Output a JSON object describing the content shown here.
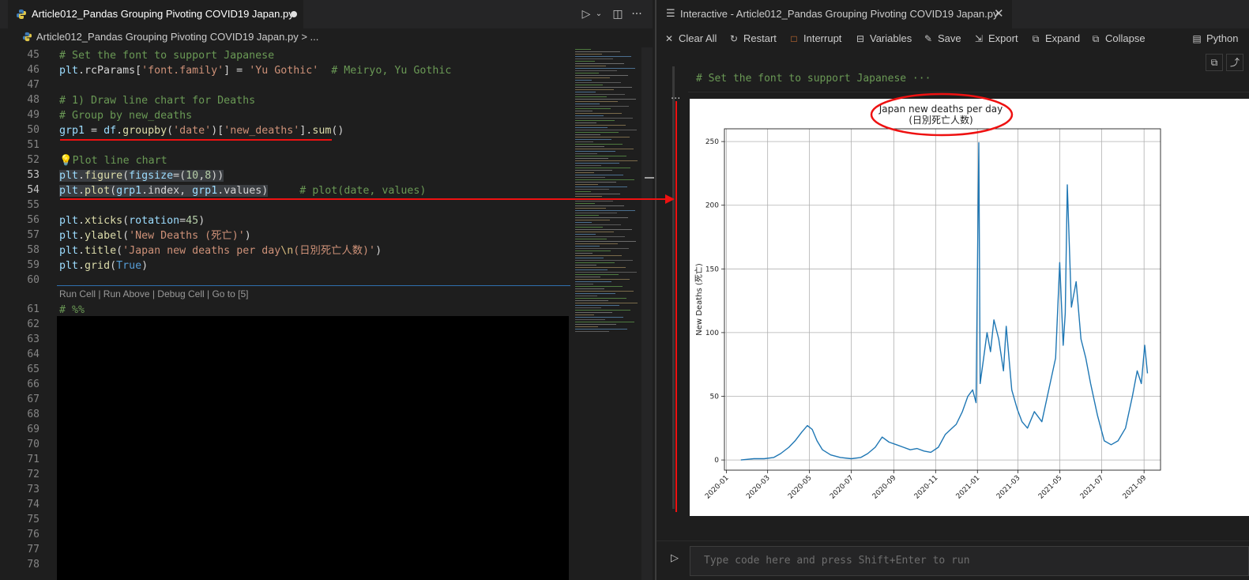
{
  "editor": {
    "tab_title": "Article012_Pandas Grouping Pivoting COVID19 Japan.py",
    "breadcrumb_file": "Article012_Pandas Grouping Pivoting COVID19 Japan.py",
    "breadcrumb_more": "> ...",
    "codelens": "Run Cell | Run Above | Debug Cell | Go to [5]",
    "line_numbers": [
      "45",
      "46",
      "47",
      "48",
      "49",
      "50",
      "51",
      "52",
      "53",
      "54",
      "55",
      "56",
      "57",
      "58",
      "59",
      "60",
      "61",
      "62",
      "63",
      "64",
      "65",
      "66",
      "67",
      "68",
      "69",
      "70",
      "71",
      "72",
      "73",
      "74",
      "75",
      "76",
      "77",
      "78"
    ],
    "code": {
      "l45": "# Set the font to support Japanese",
      "l46a": "plt",
      "l46b": ".rcParams[",
      "l46c": "'font.family'",
      "l46d": "] = ",
      "l46e": "'Yu Gothic'",
      "l46f": "  # Meiryo, Yu Gothic",
      "l48": "# 1) Draw line chart for Deaths",
      "l49": "# Group by new_deaths",
      "l50a": "grp1",
      "l50b": " = ",
      "l50c": "df",
      "l50d": ".",
      "l50e": "groupby",
      "l50f": "(",
      "l50g": "'date'",
      "l50h": ")[",
      "l50i": "'new_deaths'",
      "l50j": "].",
      "l50k": "sum",
      "l50l": "()",
      "l52": "Plot line chart",
      "l53a": "plt",
      "l53b": ".",
      "l53c": "figure",
      "l53d": "(",
      "l53e": "figsize",
      "l53f": "=(",
      "l53g": "10",
      "l53h": ",",
      "l53i": "8",
      "l53j": "))",
      "l54a": "plt",
      "l54b": ".",
      "l54c": "plot",
      "l54d": "(",
      "l54e": "grp1",
      "l54f": ".index, ",
      "l54g": "grp1",
      "l54h": ".values)",
      "l54i": "     # plot(date, values)",
      "l56a": "plt",
      "l56b": ".",
      "l56c": "xticks",
      "l56d": "(",
      "l56e": "rotation",
      "l56f": "=",
      "l56g": "45",
      "l56h": ")",
      "l57a": "plt",
      "l57b": ".",
      "l57c": "ylabel",
      "l57d": "(",
      "l57e": "'New Deaths (死亡)'",
      "l57f": ")",
      "l58a": "plt",
      "l58b": ".",
      "l58c": "title",
      "l58d": "(",
      "l58e": "'Japan new deaths per day",
      "l58f": "\\n",
      "l58g": "(日別死亡人数)'",
      "l58h": ")",
      "l59a": "plt",
      "l59b": ".",
      "l59c": "grid",
      "l59d": "(",
      "l59e": "True",
      "l59f": ")",
      "l61": "# %%"
    }
  },
  "interactive": {
    "tab_title": "Interactive - Article012_Pandas Grouping Pivoting COVID19 Japan.py",
    "toolbar": {
      "clear_all": "Clear All",
      "restart": "Restart",
      "interrupt": "Interrupt",
      "variables": "Variables",
      "save": "Save",
      "export": "Export",
      "expand": "Expand",
      "collapse": "Collapse",
      "python": "Python"
    },
    "folded_cell": "# Set the font to support Japanese ···",
    "cell_ellipsis": "···",
    "input_placeholder": "Type code here and press Shift+Enter to run"
  },
  "chart_data": {
    "type": "line",
    "title": "Japan new deaths per day",
    "subtitle": "(日別死亡人数)",
    "xlabel": "",
    "ylabel": "New Deaths (死亡)",
    "x_tick_labels": [
      "2020-01",
      "2020-03",
      "2020-05",
      "2020-07",
      "2020-09",
      "2020-11",
      "2021-01",
      "2021-03",
      "2021-05",
      "2021-07",
      "2021-09"
    ],
    "y_ticks": [
      0,
      50,
      100,
      150,
      200,
      250
    ],
    "ylim": [
      -8,
      260
    ],
    "grid": true,
    "line_color": "#1f77b4",
    "series": [
      {
        "x": [
          "2020-01-22",
          "2020-02-10",
          "2020-02-25",
          "2020-03-10",
          "2020-03-20",
          "2020-04-01",
          "2020-04-10",
          "2020-04-20",
          "2020-04-28",
          "2020-05-05",
          "2020-05-12",
          "2020-05-20",
          "2020-06-01",
          "2020-06-15",
          "2020-07-01",
          "2020-07-15",
          "2020-07-25",
          "2020-08-05",
          "2020-08-15",
          "2020-08-25",
          "2020-09-05",
          "2020-09-15",
          "2020-09-25",
          "2020-10-05",
          "2020-10-15",
          "2020-10-25",
          "2020-11-05",
          "2020-11-15",
          "2020-11-25",
          "2020-12-01",
          "2020-12-10",
          "2020-12-18",
          "2020-12-25",
          "2020-12-30",
          "2021-01-03",
          "2021-01-05",
          "2021-01-10",
          "2021-01-15",
          "2021-01-20",
          "2021-01-25",
          "2021-02-01",
          "2021-02-08",
          "2021-02-12",
          "2021-02-20",
          "2021-02-28",
          "2021-03-07",
          "2021-03-15",
          "2021-03-25",
          "2021-04-05",
          "2021-04-15",
          "2021-04-25",
          "2021-05-01",
          "2021-05-06",
          "2021-05-09",
          "2021-05-12",
          "2021-05-18",
          "2021-05-25",
          "2021-06-01",
          "2021-06-08",
          "2021-06-15",
          "2021-06-25",
          "2021-07-05",
          "2021-07-15",
          "2021-07-25",
          "2021-08-05",
          "2021-08-15",
          "2021-08-22",
          "2021-08-28",
          "2021-09-02",
          "2021-09-06"
        ],
        "values": [
          0,
          1,
          1,
          2,
          5,
          10,
          15,
          22,
          27,
          24,
          15,
          8,
          4,
          2,
          1,
          2,
          5,
          10,
          18,
          14,
          12,
          10,
          8,
          9,
          7,
          6,
          10,
          20,
          25,
          28,
          38,
          50,
          55,
          45,
          249,
          60,
          80,
          100,
          85,
          110,
          95,
          70,
          105,
          55,
          40,
          30,
          25,
          38,
          30,
          55,
          80,
          155,
          90,
          115,
          216,
          120,
          140,
          95,
          80,
          60,
          35,
          15,
          12,
          15,
          25,
          50,
          70,
          60,
          90,
          68
        ]
      }
    ]
  }
}
